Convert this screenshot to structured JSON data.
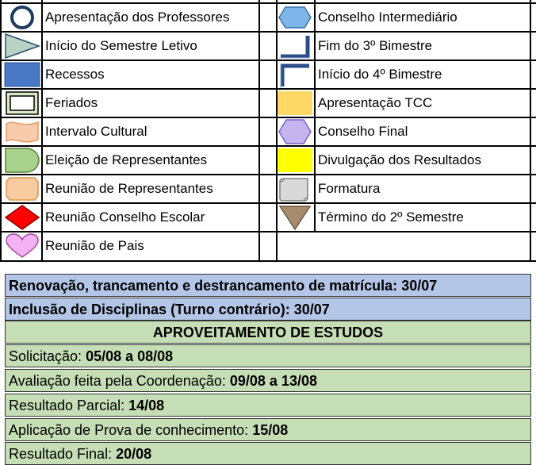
{
  "legend": {
    "left": [
      {
        "icon": "circle-outline-icon",
        "label": "Apresentação dos Professores"
      },
      {
        "icon": "triangle-right-icon",
        "label": "Início do Semestre Letivo"
      },
      {
        "icon": "blue-rectangle-icon",
        "label": "Recessos"
      },
      {
        "icon": "double-border-box-icon",
        "label": "Feriados"
      },
      {
        "icon": "wave-flag-icon",
        "label": "Intervalo Cultural"
      },
      {
        "icon": "d-shape-icon",
        "label": "Eleição de Representantes"
      },
      {
        "icon": "octagon-icon",
        "label": "Reunião de Representantes"
      },
      {
        "icon": "red-diamond-icon",
        "label": "Reunião Conselho Escolar"
      },
      {
        "icon": "heart-icon",
        "label": "Reunião de Pais"
      }
    ],
    "right": [
      {
        "icon": "hexagon-icon",
        "label": "Conselho Intermediário"
      },
      {
        "icon": "bottom-right-corner-icon",
        "label": "Fim do 3º Bimestre"
      },
      {
        "icon": "top-left-corner-icon",
        "label": "Início do 4º Bimestre"
      },
      {
        "icon": "yellow-orange-box-icon",
        "label": "Apresentação TCC"
      },
      {
        "icon": "purple-hexagon-icon",
        "label": "Conselho Final"
      },
      {
        "icon": "yellow-box-icon",
        "label": "Divulgação dos Resultados"
      },
      {
        "icon": "scroll-icon",
        "label": "Formatura"
      },
      {
        "icon": "inverted-triangle-icon",
        "label": "Término do 2º Semestre"
      }
    ]
  },
  "notes": {
    "renovacao": {
      "label": "Renovação, trancamento e destrancamento de matrícula:",
      "value": "30/07"
    },
    "inclusao": {
      "label": "Inclusão de Disciplinas (Turno contrário):",
      "value": "30/07"
    },
    "aproveitamento_title": "APROVEITAMENTO DE ESTUDOS",
    "items": [
      {
        "label": "Solicitação:",
        "value": "05/08 a 08/08"
      },
      {
        "label": "Avaliação feita pela Coordenação:",
        "value": "09/08 a 13/08"
      },
      {
        "label": "Resultado Parcial:",
        "value": "14/08"
      },
      {
        "label": "Aplicação de Prova de conhecimento:",
        "value": "15/08"
      },
      {
        "label": "Resultado Final:",
        "value": "20/08"
      }
    ]
  }
}
